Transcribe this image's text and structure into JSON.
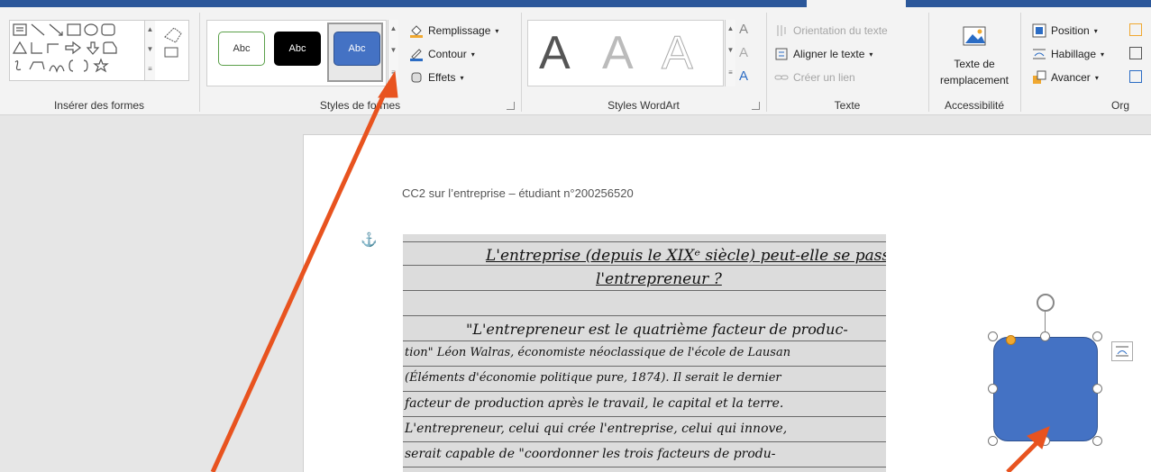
{
  "ribbon": {
    "groups": {
      "insert_shapes": "Insérer des formes",
      "shape_styles": "Styles de formes",
      "wordart_styles": "Styles WordArt",
      "text": "Texte",
      "accessibility": "Accessibilité",
      "arrange": "Org"
    },
    "shape_styles": {
      "abc1": "Abc",
      "abc2": "Abc",
      "abc3": "Abc",
      "fill": "Remplissage",
      "outline": "Contour",
      "effects": "Effets"
    },
    "wordart": {
      "letter": "A",
      "letter_small": "A"
    },
    "text": {
      "orientation": "Orientation du texte",
      "align": "Aligner le texte",
      "link": "Créer un lien"
    },
    "accessibility": {
      "alt_text_line1": "Texte de",
      "alt_text_line2": "remplacement"
    },
    "arrange": {
      "position": "Position",
      "wrap": "Habillage",
      "forward": "Avancer"
    }
  },
  "document": {
    "header": "CC2 sur l’entreprise – étudiant n°200256520",
    "handwriting": [
      "L'entreprise (depuis le XIXᵉ siècle) peut-elle se passer de",
      "l'entrepreneur ?",
      "\"L'entrepreneur est le quatrième facteur de produc-",
      "tion\" Léon Walras, économiste néoclassique de l'école de Lausan",
      "(Éléments d'économie politique pure, 1874). Il serait le dernier",
      "facteur de production après le travail, le capital et la terre.",
      "L'entrepreneur, celui qui crée l'entreprise, celui qui innove,",
      "serait capable de \"coordonner les trois facteurs de produ-"
    ]
  },
  "colors": {
    "accent": "#2b579a",
    "shape_fill": "#4472c4",
    "arrow": "#e8531f"
  }
}
